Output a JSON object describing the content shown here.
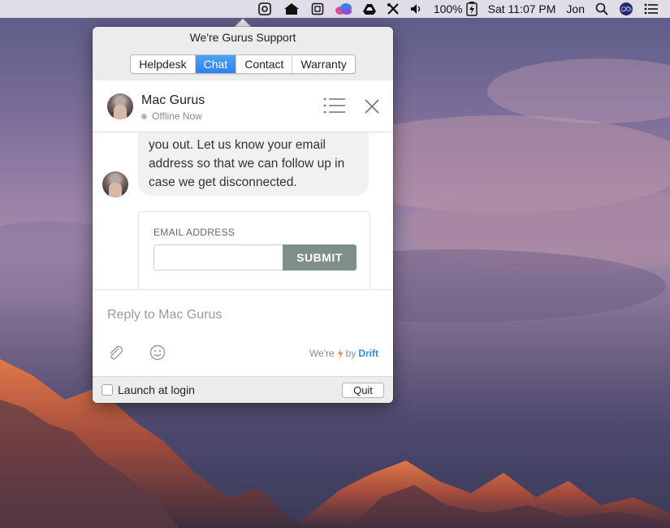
{
  "menubar": {
    "battery_percent": "100%",
    "clock": "Sat 11:07 PM",
    "user": "Jon",
    "icons": [
      "gear-badge-icon",
      "home-icon",
      "clipboard-icon",
      "creative-cloud-icon",
      "google-drive-icon",
      "tools-icon",
      "volume-icon",
      "battery-icon",
      "spotlight-search-icon",
      "siri-icon",
      "notification-center-icon"
    ]
  },
  "popover": {
    "title": "We're Gurus Support",
    "tabs": [
      {
        "label": "Helpdesk",
        "active": false
      },
      {
        "label": "Chat",
        "active": true
      },
      {
        "label": "Contact",
        "active": false
      },
      {
        "label": "Warranty",
        "active": false
      }
    ],
    "accent": "#2a82f0"
  },
  "chat": {
    "agent_name": "Mac Gurus",
    "status": "Offline Now",
    "message_lines": [
      "you out. Let us know your email",
      "address so that we can follow up in",
      "case we get disconnected."
    ],
    "email_label": "EMAIL ADDRESS",
    "email_value": "",
    "submit_label": "SUBMIT",
    "reply_placeholder": "Reply to Mac Gurus",
    "brand_prefix": "We're",
    "brand_by": "by",
    "brand_name": "Drift",
    "brand_color": "#2f8fe6"
  },
  "footer": {
    "launch_label": "Launch at login",
    "launch_checked": false,
    "quit_label": "Quit"
  }
}
